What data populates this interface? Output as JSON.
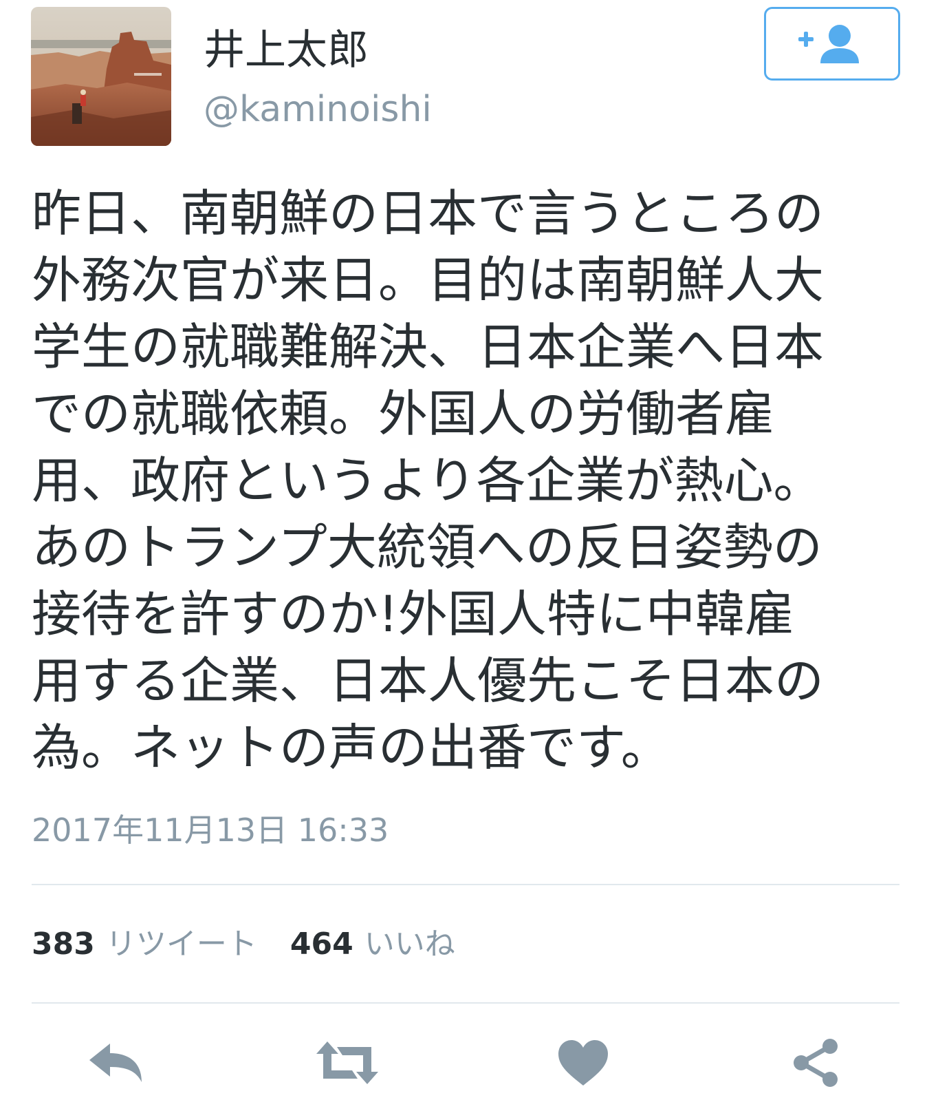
{
  "user": {
    "display_name": "井上太郎",
    "handle": "@kaminoishi",
    "avatar_icon": "landscape-photo-avatar"
  },
  "follow_button": {
    "icon": "follow-user-icon",
    "color": "#55acee"
  },
  "tweet": {
    "lines": [
      "昨日、南朝鮮の日本で言うところの",
      "外務次官が来日。目的は南朝鮮人大",
      "学生の就職難解決、日本企業へ日本",
      "での就職依頼。外国人の労働者雇",
      "用、政府というより各企業が熱心。",
      "あのトランプ大統領への反日姿勢の",
      "接待を許すのか!外国人特に中韓雇",
      "用する企業、日本人優先こそ日本の",
      "為。ネットの声の出番です。"
    ],
    "timestamp": "2017年11月13日 16:33"
  },
  "stats": {
    "retweet_count": "383",
    "retweet_label": "リツイート",
    "like_count": "464",
    "like_label": "いいね"
  },
  "actions": {
    "icons": [
      "reply-icon",
      "retweet-icon",
      "like-icon",
      "share-icon"
    ],
    "icon_color": "#8899a6"
  }
}
